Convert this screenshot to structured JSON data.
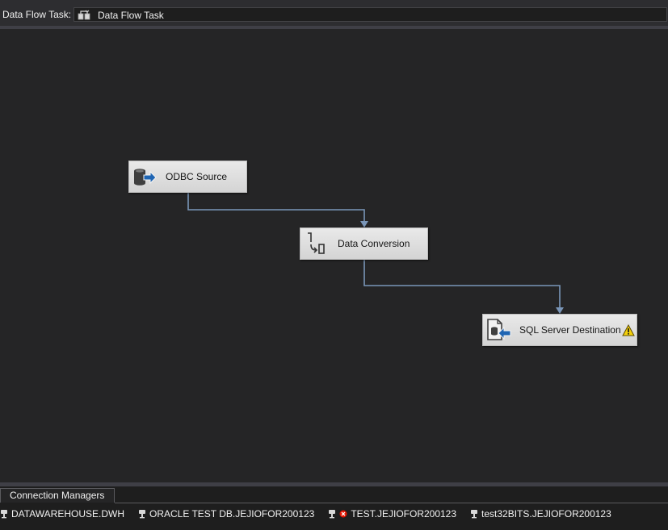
{
  "task_bar": {
    "label": "Data Flow Task:",
    "selected_task": "Data Flow Task"
  },
  "canvas": {
    "components": {
      "odbc_source": {
        "label": "ODBC Source",
        "icon": "odbc-source-icon"
      },
      "data_conversion": {
        "label": "Data Conversion",
        "icon": "data-conversion-icon"
      },
      "sql_server_destination": {
        "label": "SQL Server Destination",
        "icon": "sql-destination-icon",
        "status_icon": "warning-icon"
      }
    }
  },
  "connection_managers": {
    "tab_label": "Connection Managers",
    "items": [
      {
        "name": "DATAWAREHOUSE.DWH",
        "icon": "connection-plug-icon"
      },
      {
        "name": "ORACLE TEST DB.JEJIOFOR200123",
        "icon": "connection-plug-icon"
      },
      {
        "name": "TEST.JEJIOFOR200123",
        "icon": "connection-plug-icon",
        "status_icon": "error-icon"
      },
      {
        "name": "test32BITS.JEJIOFOR200123",
        "icon": "connection-plug-icon"
      }
    ]
  },
  "colors": {
    "canvas_background": "#252526",
    "connector": "#7a96b8",
    "component_fill": "#dcdcdc",
    "warning": "#f5d10a",
    "error": "#e51400"
  }
}
